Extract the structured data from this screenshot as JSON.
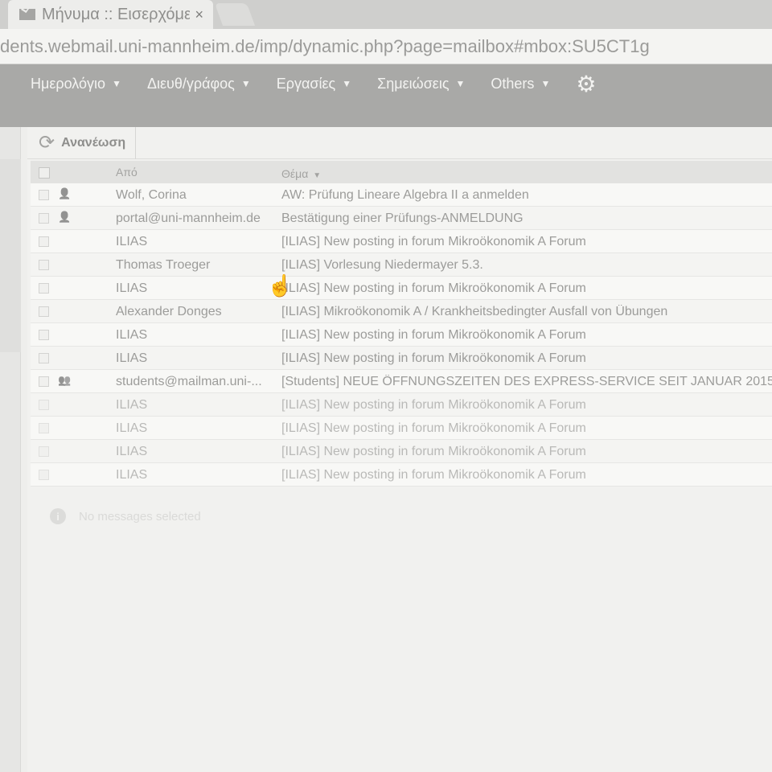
{
  "browser": {
    "tab_title": "Μήνυμα :: Εισερχόμε",
    "tab_close": "×",
    "url": "dents.webmail.uni-mannheim.de/imp/dynamic.php?page=mailbox#mbox:SU5CT1g"
  },
  "nav": {
    "items": [
      {
        "label": "Ημερολόγιο"
      },
      {
        "label": "Διευθ/γράφος"
      },
      {
        "label": "Εργασίες"
      },
      {
        "label": "Σημειώσεις"
      },
      {
        "label": "Others"
      }
    ],
    "caret": "▼",
    "gear": "⚙"
  },
  "toolbar": {
    "refresh_label": "Ανανέωση"
  },
  "list": {
    "header_from": "Από",
    "header_subject": "Θέμα",
    "rows": [
      {
        "from": "Wolf, Corina",
        "subject": "AW: Prüfung Lineare Algebra II a anmelden",
        "icon": "person-icon"
      },
      {
        "from": "portal@uni-mannheim.de",
        "subject": "Bestätigung einer Prüfungs-ANMELDUNG",
        "icon": "person-icon"
      },
      {
        "from": "ILIAS",
        "subject": "[ILIAS] New posting in forum Mikroökonomik A Forum",
        "icon": ""
      },
      {
        "from": "Thomas Troeger",
        "subject": "[ILIAS] Vorlesung Niedermayer 5.3.",
        "icon": ""
      },
      {
        "from": "ILIAS",
        "subject": "[ILIAS] New posting in forum Mikroökonomik A Forum",
        "icon": ""
      },
      {
        "from": "Alexander Donges",
        "subject": "[ILIAS] Mikroökonomik A / Krankheitsbedingter Ausfall von Übungen",
        "icon": ""
      },
      {
        "from": "ILIAS",
        "subject": "[ILIAS] New posting in forum Mikroökonomik A Forum",
        "icon": ""
      },
      {
        "from": "ILIAS",
        "subject": "[ILIAS] New posting in forum Mikroökonomik A Forum",
        "icon": ""
      },
      {
        "from": "students@mailman.uni-...",
        "subject": "[Students] NEUE ÖFFNUNGSZEITEN DES EXPRESS-SERVICE SEIT JANUAR 2015",
        "icon": "group-icon"
      },
      {
        "from": "ILIAS",
        "subject": "[ILIAS] New posting in forum Mikroökonomik A Forum",
        "icon": ""
      },
      {
        "from": "ILIAS",
        "subject": "[ILIAS] New posting in forum Mikroökonomik A Forum",
        "icon": ""
      },
      {
        "from": "ILIAS",
        "subject": "[ILIAS] New posting in forum Mikroökonomik A Forum",
        "icon": ""
      },
      {
        "from": "ILIAS",
        "subject": "[ILIAS] New posting in forum Mikroökonomik A Forum",
        "icon": ""
      }
    ]
  },
  "preview": {
    "message": "No messages selected"
  }
}
